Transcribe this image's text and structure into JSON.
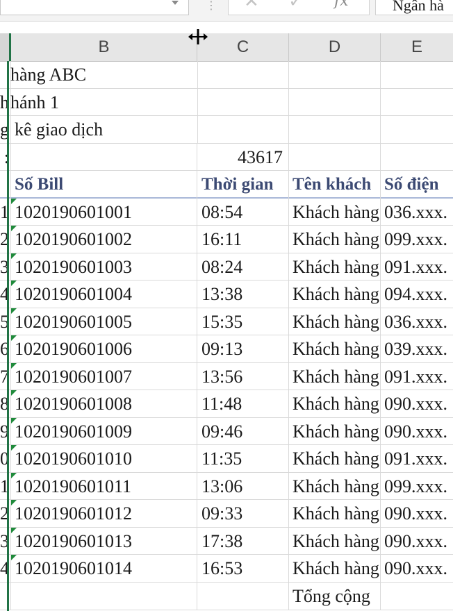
{
  "formula_bar": {
    "cancel_icon": "close-icon",
    "enter_icon": "checkmark-icon",
    "fx_label": "fx",
    "formula_value": "Ngân hà"
  },
  "columns": [
    "B",
    "C",
    "D",
    "E"
  ],
  "top_rows": [
    {
      "a": "",
      "b": "hàng ABC",
      "c": "",
      "d": "",
      "e": ""
    },
    {
      "a": "",
      "b": "hánh 1",
      "c": "",
      "d": "",
      "e": ""
    },
    {
      "a": "",
      "b": "kê giao dịch",
      "c": "",
      "d": "",
      "e": ""
    },
    {
      "a": ":",
      "b": "",
      "c": "43617",
      "d": "",
      "e": ""
    }
  ],
  "a_prefixes": [
    "h",
    "g"
  ],
  "table_header": {
    "bill": "Số Bill",
    "time": "Thời gian",
    "customer": "Tên khách",
    "phone": "Số điện"
  },
  "rows": [
    {
      "a": "1",
      "bill": "1020190601001",
      "time": "08:54",
      "customer": "Khách hàng",
      "phone": "036.xxx."
    },
    {
      "a": "2",
      "bill": "1020190601002",
      "time": "16:11",
      "customer": "Khách hàng",
      "phone": "099.xxx."
    },
    {
      "a": "3",
      "bill": "1020190601003",
      "time": "08:24",
      "customer": "Khách hàng",
      "phone": "091.xxx."
    },
    {
      "a": "4",
      "bill": "1020190601004",
      "time": "13:38",
      "customer": "Khách hàng",
      "phone": "094.xxx."
    },
    {
      "a": "5",
      "bill": "1020190601005",
      "time": "15:35",
      "customer": "Khách hàng",
      "phone": "036.xxx."
    },
    {
      "a": "6",
      "bill": "1020190601006",
      "time": "09:13",
      "customer": "Khách hàng",
      "phone": "039.xxx."
    },
    {
      "a": "7",
      "bill": "1020190601007",
      "time": "13:56",
      "customer": "Khách hàng",
      "phone": "091.xxx."
    },
    {
      "a": "8",
      "bill": "1020190601008",
      "time": "11:48",
      "customer": "Khách hàng",
      "phone": "090.xxx."
    },
    {
      "a": "9",
      "bill": "1020190601009",
      "time": "09:46",
      "customer": "Khách hàng",
      "phone": "090.xxx."
    },
    {
      "a": "0",
      "bill": "1020190601010",
      "time": "11:35",
      "customer": "Khách hàng",
      "phone": "091.xxx."
    },
    {
      "a": "1",
      "bill": "1020190601011",
      "time": "13:06",
      "customer": "Khách hàng",
      "phone": "099.xxx."
    },
    {
      "a": "2",
      "bill": "1020190601012",
      "time": "09:33",
      "customer": "Khách hàng",
      "phone": "090.xxx."
    },
    {
      "a": "3",
      "bill": "1020190601013",
      "time": "17:38",
      "customer": "Khách hàng",
      "phone": "090.xxx."
    },
    {
      "a": "4",
      "bill": "1020190601014",
      "time": "16:53",
      "customer": "Khách hàng",
      "phone": "090.xxx."
    }
  ],
  "total_label": "Tổng cộng",
  "colors": {
    "header_text": "#3c4a73",
    "error_indicator": "#1f8a3b",
    "selection": "#217346"
  }
}
